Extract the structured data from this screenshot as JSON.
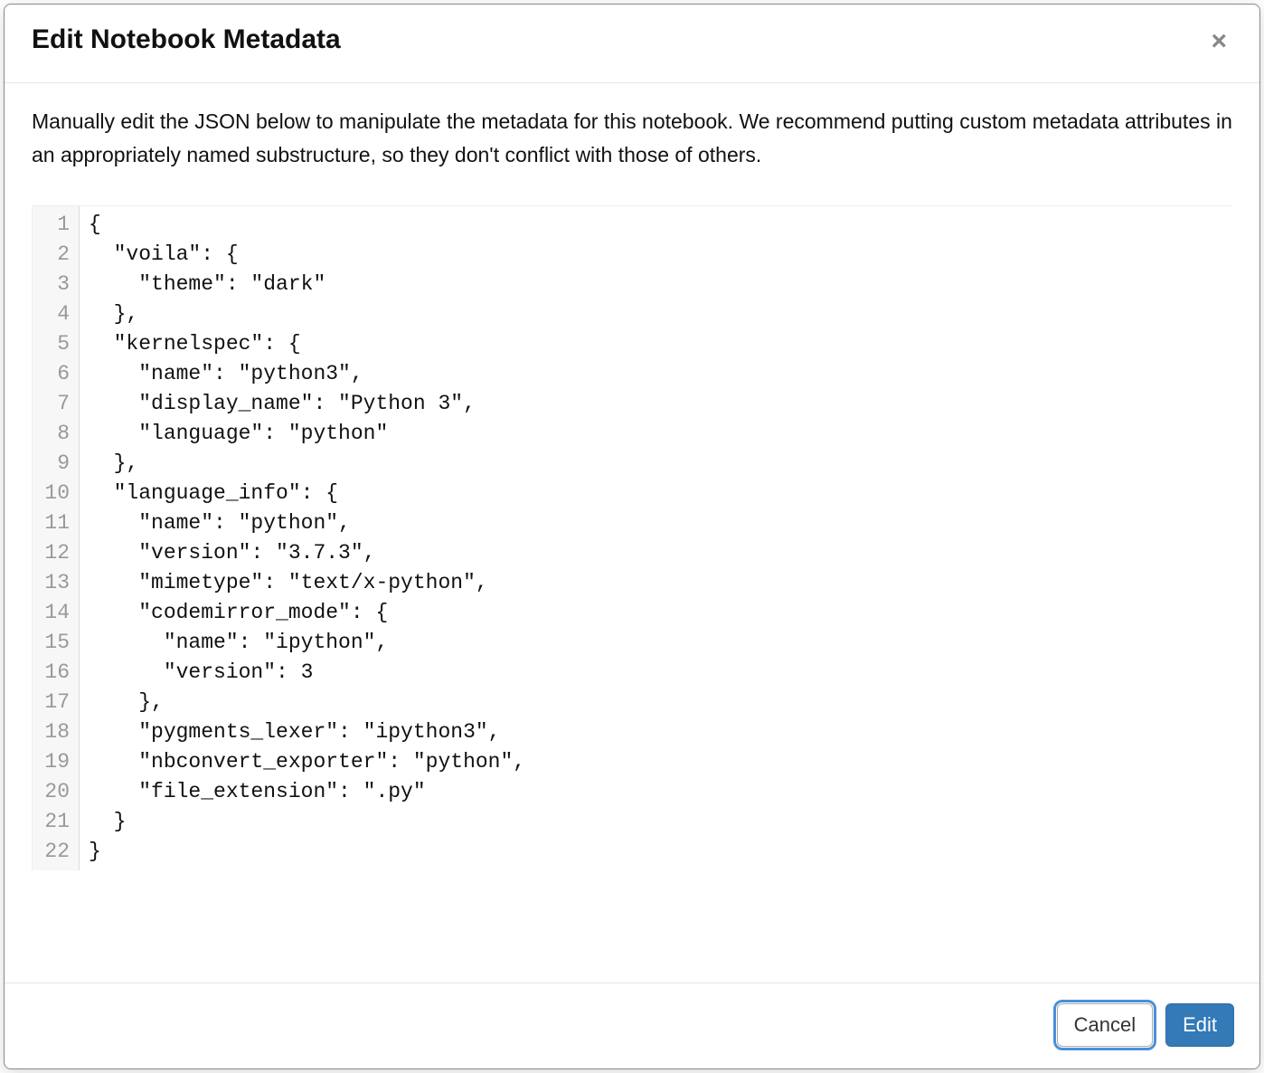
{
  "dialog": {
    "title": "Edit Notebook Metadata",
    "close_glyph": "×",
    "instruction": "Manually edit the JSON below to manipulate the metadata for this notebook. We recommend putting custom metadata attributes in an appropriately named substructure, so they don't conflict with those of others.",
    "buttons": {
      "cancel": "Cancel",
      "edit": "Edit"
    }
  },
  "editor": {
    "line_numbers": [
      "1",
      "2",
      "3",
      "4",
      "5",
      "6",
      "7",
      "8",
      "9",
      "10",
      "11",
      "12",
      "13",
      "14",
      "15",
      "16",
      "17",
      "18",
      "19",
      "20",
      "21",
      "22"
    ],
    "content": "{\n  \"voila\": {\n    \"theme\": \"dark\"\n  },\n  \"kernelspec\": {\n    \"name\": \"python3\",\n    \"display_name\": \"Python 3\",\n    \"language\": \"python\"\n  },\n  \"language_info\": {\n    \"name\": \"python\",\n    \"version\": \"3.7.3\",\n    \"mimetype\": \"text/x-python\",\n    \"codemirror_mode\": {\n      \"name\": \"ipython\",\n      \"version\": 3\n    },\n    \"pygments_lexer\": \"ipython3\",\n    \"nbconvert_exporter\": \"python\",\n    \"file_extension\": \".py\"\n  }\n}"
  }
}
